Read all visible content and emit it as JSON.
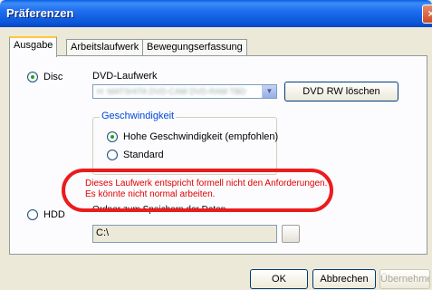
{
  "window": {
    "title": "Präferenzen",
    "close_glyph": "×"
  },
  "tabs": [
    {
      "label": "Ausgabe",
      "active": true
    },
    {
      "label": "Arbeitslaufwerk",
      "active": false
    },
    {
      "label": "Bewegungserfassung",
      "active": false
    }
  ],
  "output": {
    "disc_label": "Disc",
    "disc_selected": true,
    "drive_label": "DVD-Laufwerk",
    "drive_value": "H: MATSHITA DVD-CAM DVD-RAM TBD",
    "erase_button": "DVD RW löschen",
    "speed_group": "Geschwindigkeit",
    "speed_high": "Hohe Geschwindigkeit (empfohlen)",
    "speed_standard": "Standard",
    "warning_line1": "Dieses Laufwerk entspricht formell nicht den Anforderungen.",
    "warning_line2": "Es könnte nicht normal arbeiten.",
    "hdd_label": "HDD",
    "hdd_selected": false,
    "hdd_caption": "Ordner zum Speichern der Daten",
    "hdd_path": "C:\\"
  },
  "footer": {
    "ok": "OK",
    "cancel": "Abbrechen",
    "apply": "Übernehmen"
  },
  "colors": {
    "title_bar": "#0a55d8",
    "warning_text": "#e00000",
    "highlight": "#ea1c1c"
  },
  "icons": {
    "close": "close-icon",
    "combo_arrow": "chevron-down-icon",
    "browse": "browse-icon"
  }
}
